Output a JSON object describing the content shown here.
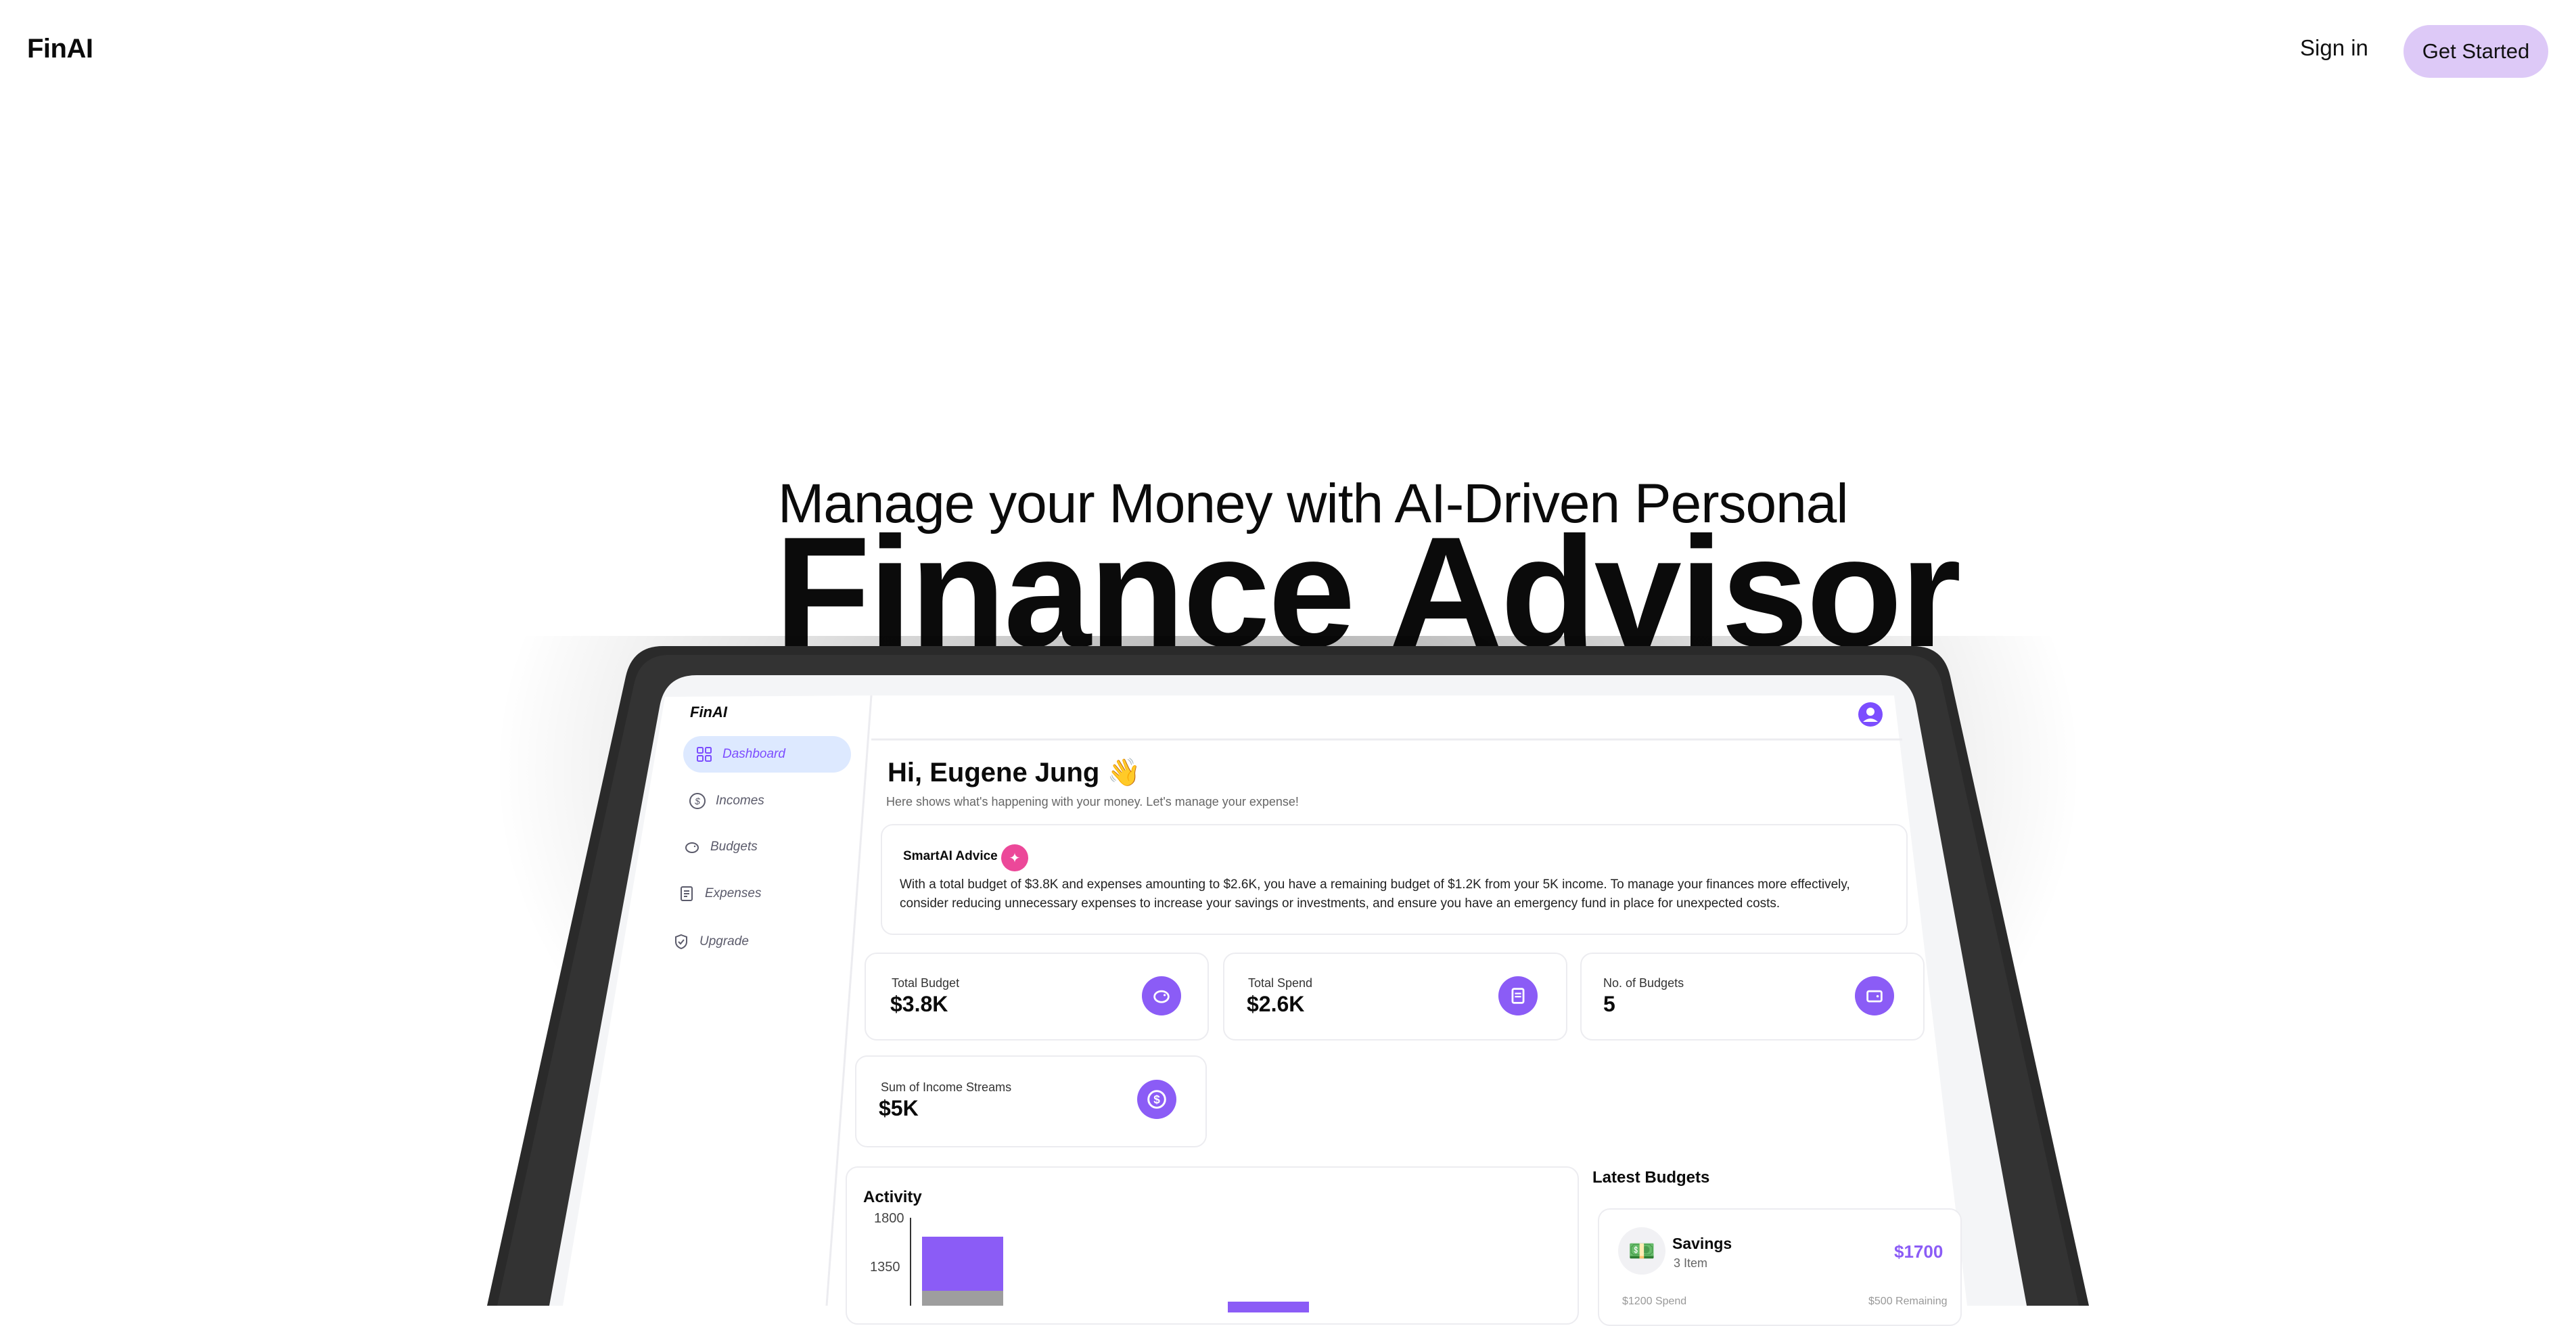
{
  "nav": {
    "logo": "FinAI",
    "signin": "Sign in",
    "get_started": "Get Started"
  },
  "hero": {
    "subtitle": "Manage your Money with AI-Driven Personal",
    "title": "Finance Advisor"
  },
  "app": {
    "logo": "FinAI",
    "sidebar": [
      {
        "label": "Dashboard",
        "icon": "grid-icon",
        "active": true
      },
      {
        "label": "Incomes",
        "icon": "dollar-circle-icon",
        "active": false
      },
      {
        "label": "Budgets",
        "icon": "piggy-bank-icon",
        "active": false
      },
      {
        "label": "Expenses",
        "icon": "receipt-icon",
        "active": false
      },
      {
        "label": "Upgrade",
        "icon": "shield-icon",
        "active": false
      }
    ],
    "greeting": "Hi, Eugene Jung 👋",
    "greeting_sub": "Here shows what's happening with your money. Let's manage your expense!",
    "advice": {
      "title": "SmartAI Advice",
      "text": "With a total budget of $3.8K and expenses amounting to $2.6K, you have a remaining budget of $1.2K from your 5K income. To manage your finances more effectively, consider reducing unnecessary expenses to increase your savings or investments, and ensure you have an emergency fund in place for unexpected costs."
    },
    "stats": [
      {
        "label": "Total Budget",
        "value": "$3.8K",
        "icon": "piggy-bank-icon"
      },
      {
        "label": "Total Spend",
        "value": "$2.6K",
        "icon": "receipt-icon"
      },
      {
        "label": "No. of Budgets",
        "value": "5",
        "icon": "wallet-icon"
      },
      {
        "label": "Sum of Income Streams",
        "value": "$5K",
        "icon": "dollar-circle-icon"
      }
    ],
    "activity": {
      "title": "Activity"
    },
    "latest": {
      "title": "Latest Budgets",
      "item": {
        "icon": "💵",
        "name": "Savings",
        "items": "3 Item",
        "amount": "$1700",
        "spend": "$1200 Spend",
        "remaining": "$500 Remaining"
      }
    },
    "colors": {
      "accent": "#8b5cf6",
      "active_bg": "#dde9ff",
      "bezel": "#2a2a2a"
    }
  },
  "chart_data": {
    "type": "bar",
    "title": "Activity",
    "y_ticks": [
      1800,
      1350
    ],
    "series": [
      {
        "values": [
          1700,
          1100
        ]
      },
      {
        "values": [
          1200,
          1000
        ]
      }
    ],
    "stacked": true,
    "categories": [
      "",
      ""
    ]
  }
}
